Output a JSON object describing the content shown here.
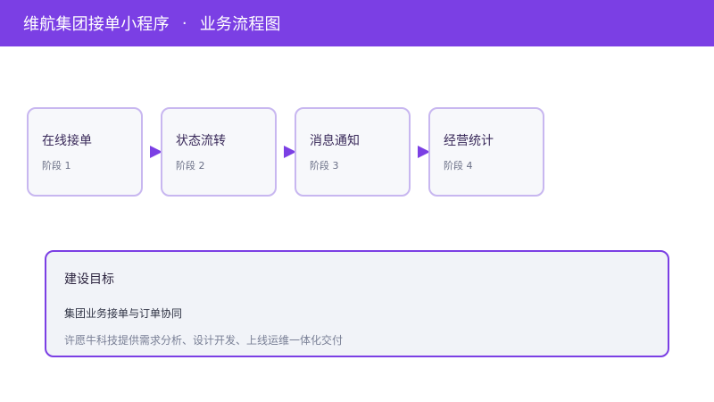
{
  "header": {
    "title": "维航集团接单小程序",
    "separator": "·",
    "subtitle": "业务流程图",
    "bg_color": "#7b3fe4"
  },
  "flow": {
    "steps": [
      {
        "title": "在线接单",
        "stage": "阶段 1"
      },
      {
        "title": "状态流转",
        "stage": "阶段 2"
      },
      {
        "title": "消息通知",
        "stage": "阶段 3"
      },
      {
        "title": "经营统计",
        "stage": "阶段 4"
      }
    ],
    "arrow_icon": "arrow-right-icon"
  },
  "goal": {
    "title": "建设目标",
    "line1": "集团业务接单与订单协同",
    "line2": "许愿牛科技提供需求分析、设计开发、上线运维一体化交付"
  }
}
